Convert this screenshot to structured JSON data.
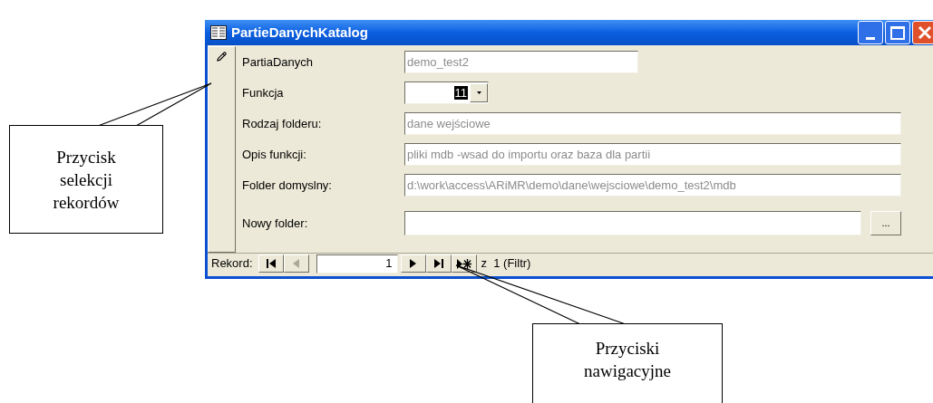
{
  "window": {
    "title": "PartieDanychKatalog"
  },
  "record_selector": {
    "editing": true
  },
  "fields": [
    {
      "kind": "short",
      "label": "PartiaDanych",
      "value": "demo_test2",
      "disabled": true
    },
    {
      "kind": "combo",
      "label": "Funkcja",
      "value": "11",
      "disabled": false
    },
    {
      "kind": "text",
      "label": "Rodzaj folderu:",
      "value": "dane wejściowe",
      "disabled": true
    },
    {
      "kind": "text",
      "label": "Opis funkcji:",
      "value": "pliki mdb -wsad do importu oraz baza dla partii",
      "disabled": true
    },
    {
      "kind": "text",
      "label": "Folder domyslny:",
      "value": "d:\\work\\access\\ARiMR\\demo\\dane\\wejsciowe\\demo_test2\\mdb",
      "disabled": true
    },
    {
      "kind": "browse",
      "label": "Nowy folder:",
      "button": "..."
    }
  ],
  "navigation": {
    "label": "Rekord:",
    "current": "1",
    "count": "z  1 (Filtr)",
    "buttons": [
      {
        "kind": "first",
        "disabled": false
      },
      {
        "kind": "prev",
        "disabled": true
      },
      {
        "kind": "next",
        "disabled": false
      },
      {
        "kind": "last",
        "disabled": false
      },
      {
        "kind": "new",
        "disabled": false
      }
    ]
  },
  "callouts": [
    {
      "lines": [
        "Przycisk",
        "selekcji",
        "rekordów"
      ]
    },
    {
      "lines": [
        "Przyciski",
        "nawigacyjne"
      ]
    }
  ]
}
